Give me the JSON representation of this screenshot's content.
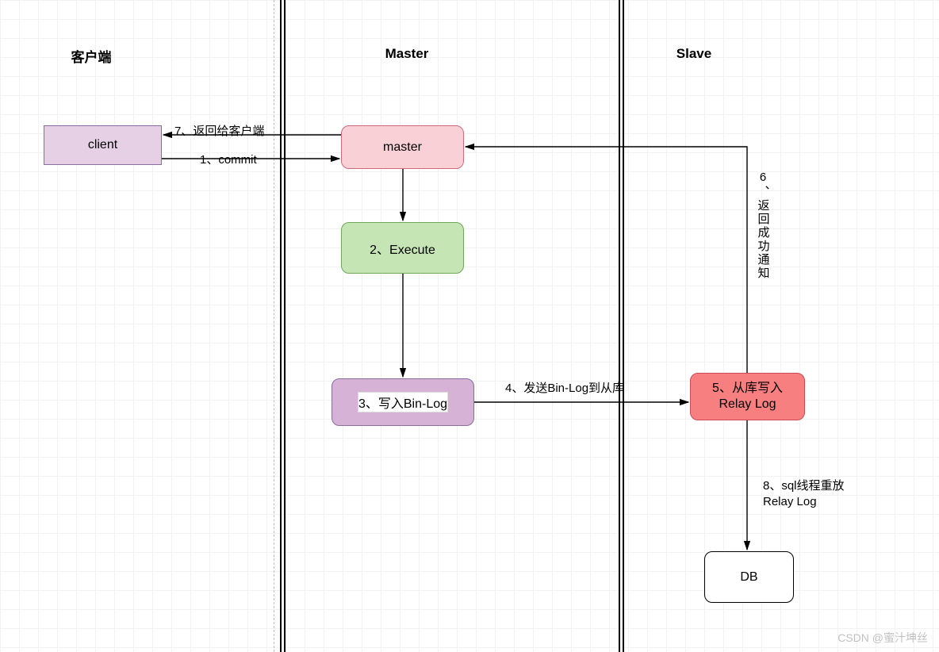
{
  "sections": {
    "client": "客户端",
    "master": "Master",
    "slave": "Slave"
  },
  "nodes": {
    "client": "client",
    "master": "master",
    "execute": "2、Execute",
    "binlog": "3、写入Bin-Log",
    "relay_line1": "5、从库写入",
    "relay_line2": "Relay Log",
    "db": "DB"
  },
  "edges": {
    "commit": "1、commit",
    "return_client": "7、返回给客户端",
    "send_binlog": "4、发送Bin-Log到从库",
    "return_success": "6、返回成功通知",
    "sql_replay_line1": "8、sql线程重放",
    "sql_replay_line2": "Relay Log"
  },
  "watermark": "CSDN @蜜汁坤丝"
}
